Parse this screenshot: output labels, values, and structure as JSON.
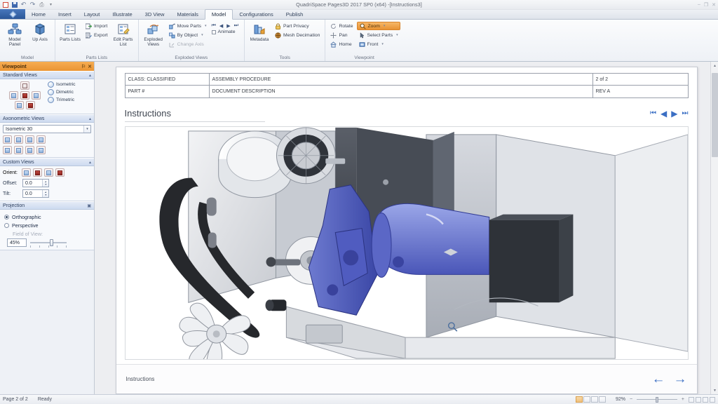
{
  "window": {
    "title": "QuadriSpace Pages3D  2017 SP0 (x64) -[Instructions3]",
    "qat": [
      {
        "name": "new",
        "glyph": ""
      },
      {
        "name": "save",
        "glyph": ""
      },
      {
        "name": "undo",
        "glyph": "↶"
      },
      {
        "name": "redo",
        "glyph": "↷"
      },
      {
        "name": "print",
        "glyph": "⎙"
      },
      {
        "name": "customize",
        "glyph": "▾"
      }
    ],
    "controls": [
      {
        "name": "minimize",
        "glyph": "–"
      },
      {
        "name": "restore",
        "glyph": "❐"
      },
      {
        "name": "close",
        "glyph": "✕"
      }
    ]
  },
  "ribbon": {
    "tabs": [
      {
        "label": "Home",
        "active": false
      },
      {
        "label": "Insert",
        "active": false
      },
      {
        "label": "Layout",
        "active": false
      },
      {
        "label": "Illustrate",
        "active": false
      },
      {
        "label": "3D View",
        "active": false
      },
      {
        "label": "Materials",
        "active": false
      },
      {
        "label": "Model",
        "active": true
      },
      {
        "label": "Configurations",
        "active": false
      },
      {
        "label": "Publish",
        "active": false
      }
    ],
    "groups": [
      {
        "title": "Model",
        "big_buttons": [
          {
            "label": "Model Panel",
            "icon": "model-panel-icon"
          },
          {
            "label": "Up Axis",
            "icon": "up-axis-icon",
            "dropdown": true
          }
        ]
      },
      {
        "title": "Parts Lists",
        "big_buttons": [
          {
            "label": "Parts Lists",
            "icon": "parts-lists-icon",
            "dropdown": true
          }
        ],
        "small_buttons": [
          {
            "label": "Import",
            "icon": "import-icon"
          },
          {
            "label": "Export",
            "icon": "export-icon"
          }
        ],
        "big_buttons_2": [
          {
            "label": "Edit Parts List",
            "icon": "edit-parts-list-icon"
          }
        ]
      },
      {
        "title": "Exploded Views",
        "big_buttons": [
          {
            "label": "Exploded Views",
            "icon": "exploded-views-icon",
            "dropdown": true
          }
        ],
        "small_buttons": [
          {
            "label": "Move Parts",
            "icon": "move-parts-icon",
            "dropdown": true,
            "disabled": false
          },
          {
            "label": "By Object",
            "icon": "by-object-icon",
            "dropdown": true,
            "disabled": false
          },
          {
            "label": "Change Axis",
            "icon": "change-axis-icon",
            "dropdown": false,
            "disabled": true
          }
        ],
        "nav": [
          {
            "name": "first-step",
            "glyph": "⏮"
          },
          {
            "name": "prev-step",
            "glyph": "◀"
          },
          {
            "name": "next-step",
            "glyph": "▶"
          },
          {
            "name": "last-step",
            "glyph": "⏭"
          }
        ],
        "checkbox": {
          "label": "Animate",
          "checked": false
        }
      },
      {
        "title": "Tools",
        "big_buttons": [
          {
            "label": "Metadata",
            "icon": "metadata-icon"
          }
        ],
        "small_buttons": [
          {
            "label": "Part Privacy",
            "icon": "part-privacy-icon"
          },
          {
            "label": "Mesh Decimation",
            "icon": "mesh-decimation-icon"
          }
        ]
      },
      {
        "title": "Viewpoint",
        "col1": [
          {
            "label": "Rotate",
            "icon": "rotate-icon",
            "active": false
          },
          {
            "label": "Pan",
            "icon": "pan-icon",
            "active": false
          },
          {
            "label": "Home",
            "icon": "home-icon",
            "active": false
          }
        ],
        "col2": [
          {
            "label": "Zoom",
            "icon": "zoom-icon",
            "active": true,
            "dropdown": true
          },
          {
            "label": "Select Parts",
            "icon": "select-parts-icon",
            "active": false,
            "dropdown": true
          },
          {
            "label": "Front",
            "icon": "front-view-icon",
            "active": false,
            "dropdown": true
          }
        ]
      }
    ]
  },
  "sidebar": {
    "panel_title": "Viewpoint",
    "panel_icons": [
      {
        "name": "pin-icon",
        "glyph": "⚐"
      },
      {
        "name": "close-panel-icon",
        "glyph": "✕"
      }
    ],
    "sections": [
      {
        "title": "Standard Views",
        "collapse_glyph": "▴",
        "view_buttons": [
          "top-view",
          "left-view",
          "front-view",
          "right-view",
          "bottom-view",
          "back-view"
        ],
        "named_views": [
          {
            "label": "Isometric",
            "icon": "isometric-icon"
          },
          {
            "label": "Dimetric",
            "icon": "dimetric-icon"
          },
          {
            "label": "Trimetric",
            "icon": "trimetric-icon"
          }
        ]
      },
      {
        "title": "Axonometric Views",
        "collapse_glyph": "▴",
        "dropdown_value": "Isometric 30",
        "row1": [
          "axo-1",
          "axo-2",
          "axo-3",
          "axo-4"
        ],
        "row2": [
          "axo-5",
          "axo-6",
          "axo-7",
          "axo-8"
        ]
      },
      {
        "title": "Custom Views",
        "collapse_glyph": "▴",
        "orient_label": "Orient:",
        "orient_buttons": [
          "orient-1",
          "orient-2",
          "orient-3",
          "orient-4"
        ],
        "offset_label": "Offset:",
        "offset_value": "0.0",
        "tilt_label": "Tilt:",
        "tilt_value": "0.0"
      },
      {
        "title": "Projection",
        "collapse_glyph": "▣",
        "orthographic_label": "Orthographic",
        "orthographic_selected": true,
        "perspective_label": "Perspective",
        "perspective_selected": false,
        "fov_label": "Field of View:",
        "fov_value": "45%"
      }
    ]
  },
  "document": {
    "header_table": {
      "row1": {
        "class": "CLASS: CLASSIFIED",
        "description": "ASSEMBLY PROCEDURE",
        "page": "2 of 2"
      },
      "row2": {
        "part": "PART #",
        "description": "DOCUMENT DESCRIPTION",
        "rev": "REV A"
      }
    },
    "instructions_title": "Instructions",
    "nav_buttons": [
      {
        "name": "first-page-button",
        "glyph": "⏮"
      },
      {
        "name": "prev-page-button",
        "glyph": "◀"
      },
      {
        "name": "next-page-button",
        "glyph": "▶"
      },
      {
        "name": "last-page-button",
        "glyph": "⏭"
      }
    ],
    "footer_label": "Instructions",
    "footer_arrows": [
      {
        "name": "footer-back-arrow",
        "glyph": "←"
      },
      {
        "name": "footer-forward-arrow",
        "glyph": "→"
      }
    ],
    "viewport_alt": "3D exploded CAD assembly: blue motor, drive belt, cooling fan and gray machine housing"
  },
  "statusbar": {
    "page_label": "Page 2 of 2",
    "state_label": "Ready",
    "zoom_level": "92%",
    "zoom_minus": "−",
    "zoom_plus": "+"
  },
  "colors": {
    "accent_orange": "#ea9433",
    "accent_blue": "#3b6fc4",
    "panel_blue": "#cedbf0",
    "model_blue": "#6f7fd4"
  }
}
